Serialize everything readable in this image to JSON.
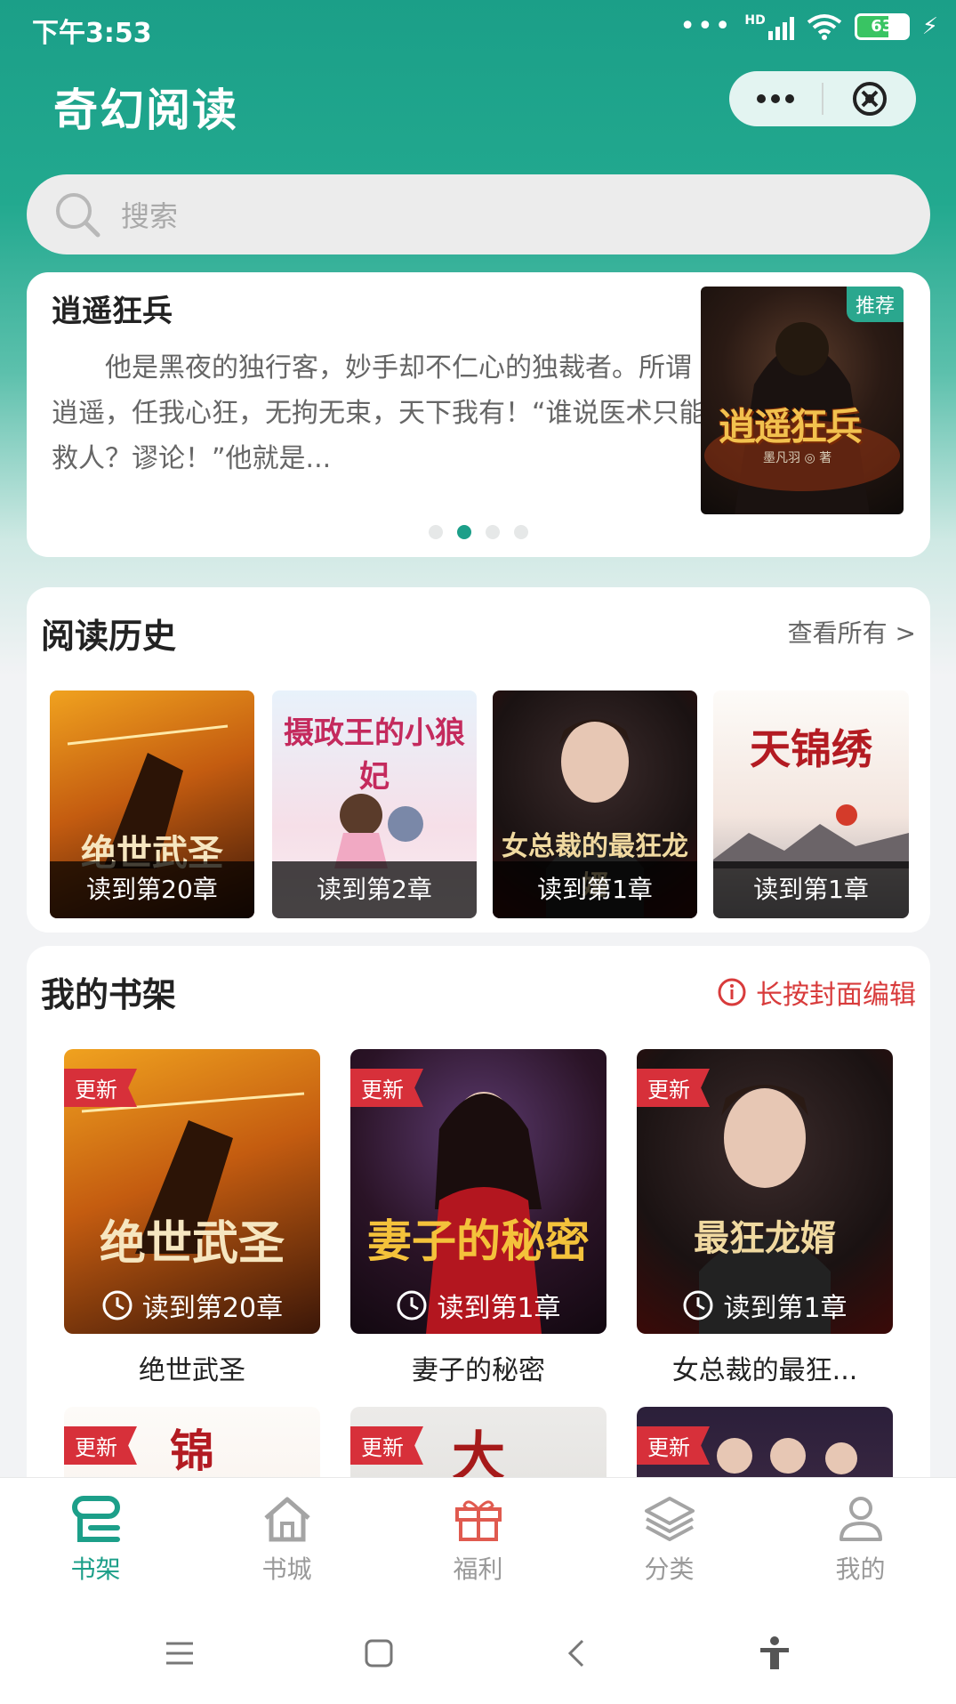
{
  "status": {
    "time": "下午3:53",
    "network": "HD",
    "battery": "63",
    "battery_level": 0.63
  },
  "header": {
    "title": "奇幻阅读"
  },
  "search": {
    "placeholder": "搜索"
  },
  "banner": {
    "title": "逍遥狂兵",
    "description": "他是黑夜的独行客，妙手却不仁心的独裁者。所谓逍遥，任我心狂，无拘无束，天下我有！“谁说医术只能救人？谬论！”他就是...",
    "badge": "推荐",
    "cover_title": "逍遥狂兵",
    "cover_author": "墨凡羽 ◎ 著",
    "active_dot": 1,
    "dot_count": 4
  },
  "history": {
    "title": "阅读历史",
    "more": "查看所有 >",
    "items": [
      {
        "progress": "读到第20章",
        "cover_text": "绝世武圣"
      },
      {
        "progress": "读到第2章",
        "cover_text": "摄政王的小狼妃"
      },
      {
        "progress": "读到第1章",
        "cover_text": "女总裁的最狂龙婿"
      },
      {
        "progress": "读到第1章",
        "cover_text": "天锦绣"
      }
    ]
  },
  "shelf": {
    "title": "我的书架",
    "tip": "长按封面编辑",
    "badge": "更新",
    "books": [
      {
        "name": "绝世武圣",
        "progress": "读到第20章",
        "cover_text": "绝世武圣"
      },
      {
        "name": "妻子的秘密",
        "progress": "读到第1章",
        "cover_text": "妻子的秘密"
      },
      {
        "name": "女总裁的最狂...",
        "progress": "读到第1章",
        "cover_text": "最狂龙婿"
      }
    ],
    "next_row": [
      {
        "cover_text": "锦"
      },
      {
        "cover_text": "大"
      },
      {
        "cover_text": ""
      }
    ]
  },
  "tabbar": {
    "items": [
      {
        "label": "书架",
        "icon": "bookshelf-icon",
        "active": true
      },
      {
        "label": "书城",
        "icon": "home-icon",
        "active": false
      },
      {
        "label": "福利",
        "icon": "gift-icon",
        "active": false
      },
      {
        "label": "分类",
        "icon": "layers-icon",
        "active": false
      },
      {
        "label": "我的",
        "icon": "user-icon",
        "active": false
      }
    ]
  },
  "colors": {
    "accent": "#1c9f89",
    "badge_red": "#d7303a",
    "gift": "#e05a4f"
  }
}
